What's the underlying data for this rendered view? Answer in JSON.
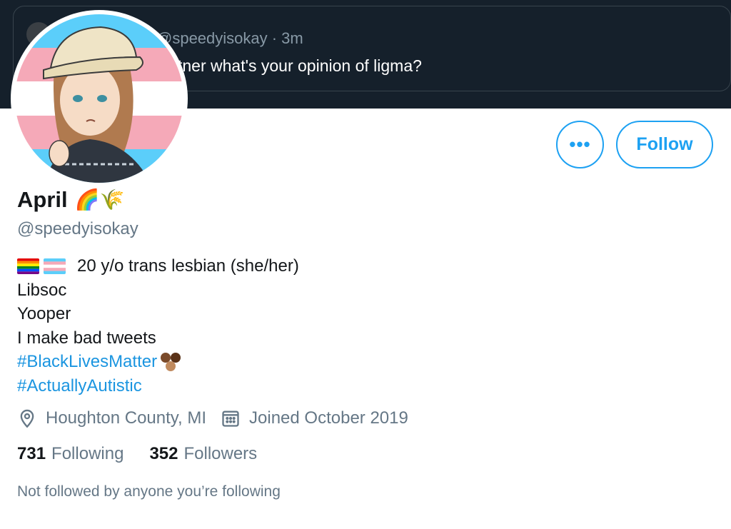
{
  "quoted_tweet": {
    "handle_time": "@speedyisokay · 3m",
    "text": "tner what's your opinion of ligma?"
  },
  "buttons": {
    "more_label": "•••",
    "follow_label": "Follow"
  },
  "profile": {
    "display_name": "April",
    "name_emojis": "🌈🌾",
    "username": "@speedyisokay",
    "bio": {
      "line1": "20 y/o trans lesbian (she/her)",
      "line2": "Libsoc",
      "line3": "Yooper",
      "line4": "I make bad tweets",
      "hashtag1": "#BlackLivesMatter",
      "hashtag2": "#ActuallyAutistic"
    },
    "location": "Houghton County, MI",
    "joined": "Joined October 2019",
    "following_count": "731",
    "following_label": "Following",
    "followers_count": "352",
    "followers_label": "Followers",
    "not_followed_text": "Not followed by anyone you’re following"
  },
  "icons": {
    "location": "location-pin-icon",
    "calendar": "calendar-icon",
    "rainbow_flag": "rainbow-flag-icon",
    "trans_flag": "trans-flag-icon",
    "fists": "raised-fists-emoji"
  },
  "colors": {
    "accent": "#1da1f2",
    "hashtag": "#1b95e0",
    "secondary_text": "#657786",
    "primary_text": "#14171a",
    "banner_bg": "#15202b"
  }
}
